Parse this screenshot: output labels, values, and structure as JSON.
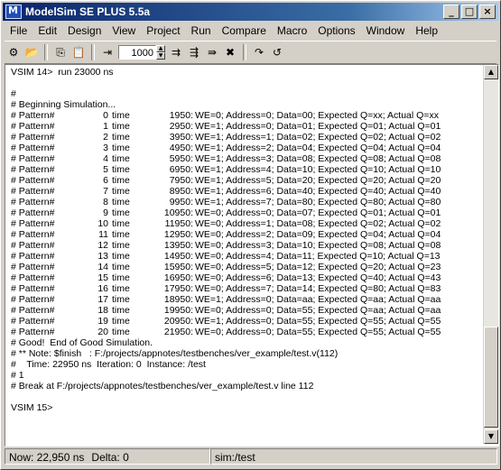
{
  "window": {
    "title": "ModelSim SE PLUS 5.5a"
  },
  "titlebar": {
    "min_glyph": "_",
    "max_glyph": "□",
    "close_glyph": "×"
  },
  "menu": [
    {
      "label": "File"
    },
    {
      "label": "Edit"
    },
    {
      "label": "Design"
    },
    {
      "label": "View"
    },
    {
      "label": "Project"
    },
    {
      "label": "Run"
    },
    {
      "label": "Compare"
    },
    {
      "label": "Macro"
    },
    {
      "label": "Options"
    },
    {
      "label": "Window"
    },
    {
      "label": "Help"
    }
  ],
  "toolbar": {
    "run_length": "1000"
  },
  "transcript": {
    "header": [
      "VSIM 14>  run 23000 ns",
      "#",
      "# Beginning Simulation..."
    ],
    "patterns": [
      {
        "label": "# Pattern#",
        "num": "0",
        "unit": "time",
        "t": "1950:",
        "detail": "WE=0; Address=0; Data=00; Expected Q=xx; Actual Q=xx"
      },
      {
        "label": "# Pattern#",
        "num": "1",
        "unit": "time",
        "t": "2950:",
        "detail": "WE=1; Address=0; Data=01; Expected Q=01; Actual Q=01"
      },
      {
        "label": "# Pattern#",
        "num": "2",
        "unit": "time",
        "t": "3950:",
        "detail": "WE=1; Address=1; Data=02; Expected Q=02; Actual Q=02"
      },
      {
        "label": "# Pattern#",
        "num": "3",
        "unit": "time",
        "t": "4950:",
        "detail": "WE=1; Address=2; Data=04; Expected Q=04; Actual Q=04"
      },
      {
        "label": "# Pattern#",
        "num": "4",
        "unit": "time",
        "t": "5950:",
        "detail": "WE=1; Address=3; Data=08; Expected Q=08; Actual Q=08"
      },
      {
        "label": "# Pattern#",
        "num": "5",
        "unit": "time",
        "t": "6950:",
        "detail": "WE=1; Address=4; Data=10; Expected Q=10; Actual Q=10"
      },
      {
        "label": "# Pattern#",
        "num": "6",
        "unit": "time",
        "t": "7950:",
        "detail": "WE=1; Address=5; Data=20; Expected Q=20; Actual Q=20"
      },
      {
        "label": "# Pattern#",
        "num": "7",
        "unit": "time",
        "t": "8950:",
        "detail": "WE=1; Address=6; Data=40; Expected Q=40; Actual Q=40"
      },
      {
        "label": "# Pattern#",
        "num": "8",
        "unit": "time",
        "t": "9950:",
        "detail": "WE=1; Address=7; Data=80; Expected Q=80; Actual Q=80"
      },
      {
        "label": "# Pattern#",
        "num": "9",
        "unit": "time",
        "t": "10950:",
        "detail": "WE=0; Address=0; Data=07; Expected Q=01; Actual Q=01"
      },
      {
        "label": "# Pattern#",
        "num": "10",
        "unit": "time",
        "t": "11950:",
        "detail": "WE=0; Address=1; Data=08; Expected Q=02; Actual Q=02"
      },
      {
        "label": "# Pattern#",
        "num": "11",
        "unit": "time",
        "t": "12950:",
        "detail": "WE=0; Address=2; Data=09; Expected Q=04; Actual Q=04"
      },
      {
        "label": "# Pattern#",
        "num": "12",
        "unit": "time",
        "t": "13950:",
        "detail": "WE=0; Address=3; Data=10; Expected Q=08; Actual Q=08"
      },
      {
        "label": "# Pattern#",
        "num": "13",
        "unit": "time",
        "t": "14950:",
        "detail": "WE=0; Address=4; Data=11; Expected Q=10; Actual Q=13"
      },
      {
        "label": "# Pattern#",
        "num": "14",
        "unit": "time",
        "t": "15950:",
        "detail": "WE=0; Address=5; Data=12; Expected Q=20; Actual Q=23"
      },
      {
        "label": "# Pattern#",
        "num": "15",
        "unit": "time",
        "t": "16950:",
        "detail": "WE=0; Address=6; Data=13; Expected Q=40; Actual Q=43"
      },
      {
        "label": "# Pattern#",
        "num": "16",
        "unit": "time",
        "t": "17950:",
        "detail": "WE=0; Address=7; Data=14; Expected Q=80; Actual Q=83"
      },
      {
        "label": "# Pattern#",
        "num": "17",
        "unit": "time",
        "t": "18950:",
        "detail": "WE=1; Address=0; Data=aa; Expected Q=aa; Actual Q=aa"
      },
      {
        "label": "# Pattern#",
        "num": "18",
        "unit": "time",
        "t": "19950:",
        "detail": "WE=0; Address=0; Data=55; Expected Q=aa; Actual Q=aa"
      },
      {
        "label": "# Pattern#",
        "num": "19",
        "unit": "time",
        "t": "20950:",
        "detail": "WE=1; Address=0; Data=55; Expected Q=55; Actual Q=55"
      },
      {
        "label": "# Pattern#",
        "num": "20",
        "unit": "time",
        "t": "21950:",
        "detail": "WE=0; Address=0; Data=55; Expected Q=55; Actual Q=55"
      }
    ],
    "footer": [
      "# Good!  End of Good Simulation.",
      "# ** Note: $finish   : F:/projects/appnotes/testbenches/ver_example/test.v(112)",
      "#    Time: 22950 ns  Iteration: 0  Instance: /test",
      "# 1",
      "# Break at F:/projects/appnotes/testbenches/ver_example/test.v line 112"
    ],
    "prompt": "VSIM 15>"
  },
  "status": {
    "now_label": "Now:",
    "now_value": "22,950 ns",
    "delta_label": "Delta:",
    "delta_value": "0",
    "context": "sim:/test"
  }
}
